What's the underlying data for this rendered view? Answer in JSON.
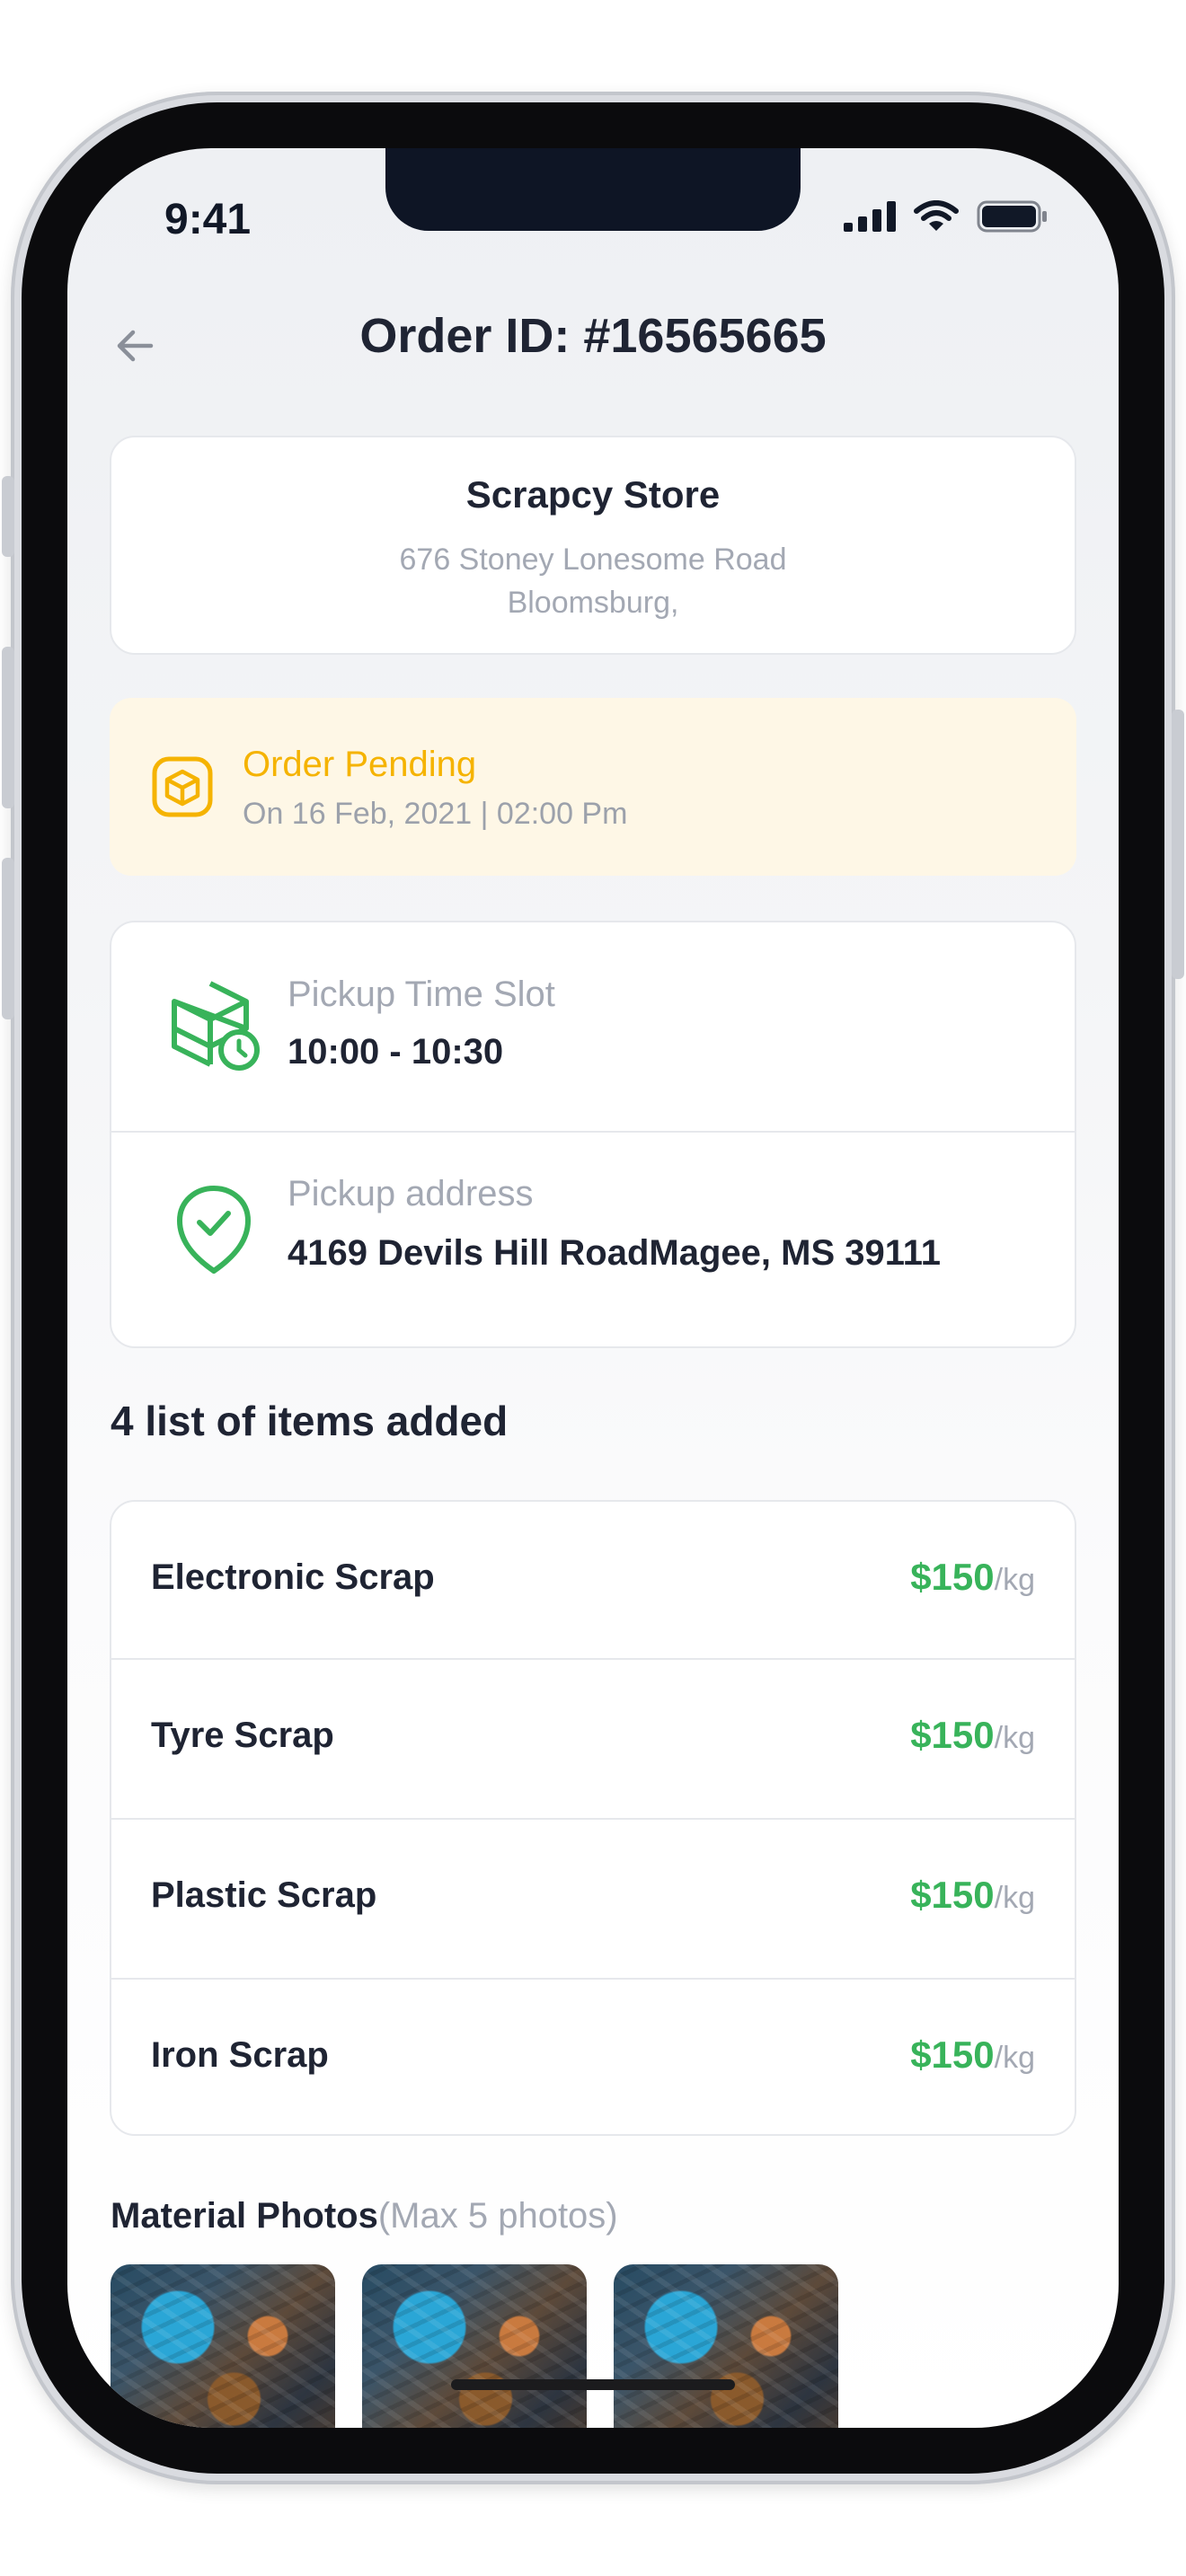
{
  "status_bar": {
    "time": "9:41"
  },
  "header": {
    "title": "Order ID: #16565665"
  },
  "store": {
    "name": "Scrapcy Store",
    "address_line1": "676 Stoney Lonesome Road",
    "address_line2": "Bloomsburg,"
  },
  "order_status": {
    "title": "Order Pending",
    "subtitle": "On 16 Feb, 2021 | 02:00 Pm",
    "color": "#f5b300"
  },
  "pickup": {
    "time_label": "Pickup Time Slot",
    "time_value": "10:00 - 10:30",
    "address_label": "Pickup address",
    "address_value": "4169 Devils Hill RoadMagee, MS 39111"
  },
  "items_section": {
    "title": "4 list of items added"
  },
  "items": [
    {
      "name": "Electronic Scrap",
      "price": "$150",
      "unit": "/kg"
    },
    {
      "name": "Tyre Scrap",
      "price": "$150",
      "unit": "/kg"
    },
    {
      "name": "Plastic Scrap",
      "price": "$150",
      "unit": "/kg"
    },
    {
      "name": "Iron Scrap",
      "price": "$150",
      "unit": "/kg"
    }
  ],
  "photos_section": {
    "title": "Material Photos",
    "hint": "(Max 5 photos)"
  },
  "colors": {
    "accent_green": "#38b35a",
    "pending": "#f5b300",
    "text_dark": "#1f2433"
  },
  "icons": [
    "back-arrow-icon",
    "cellular-signal-icon",
    "wifi-icon",
    "battery-icon",
    "box-icon",
    "box-clock-icon",
    "location-check-icon"
  ]
}
